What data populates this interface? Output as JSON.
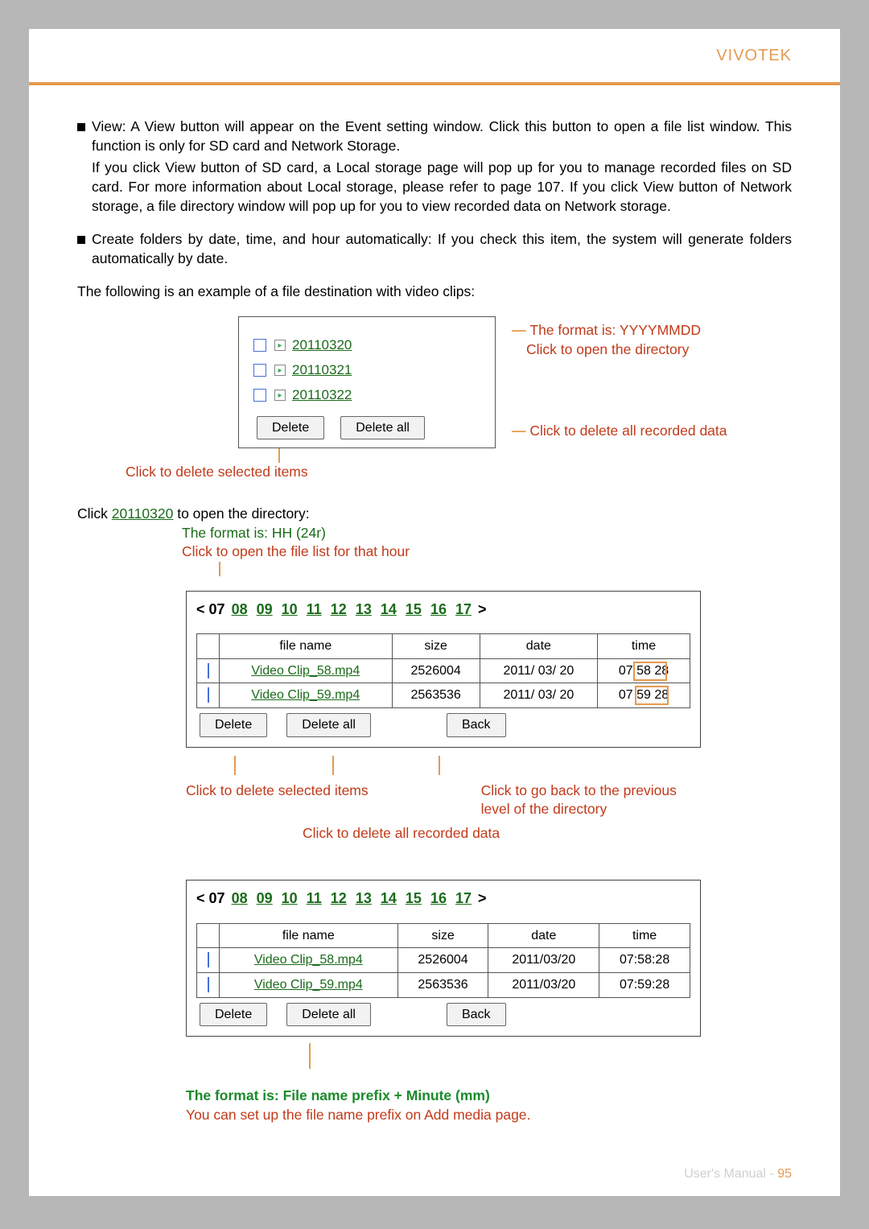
{
  "brand": "VIVOTEK",
  "view_para_1": "View: A View button will appear on the Event setting window. Click this button to open a file list window. This function is only for SD card and Network Storage.",
  "view_para_2": "If you click View button of SD card, a Local storage page will pop up for you to manage recorded files on SD card. For more information about Local storage, please refer to page 107. If you click View button of Network storage, a file directory window will pop up for you to view recorded data on Network storage.",
  "create_para": "Create folders by date, time, and hour automatically: If you check this item, the system will generate folders automatically by date.",
  "example_intro": "The following is an example of a file destination with video clips:",
  "folders": [
    "20110320",
    "20110321",
    "20110322"
  ],
  "delete_label": "Delete",
  "delete_all_label": "Delete all",
  "back_label": "Back",
  "ann_format_date": "The format is: YYYYMMDD",
  "ann_open_dir": "Click to open the directory",
  "ann_del_all": "Click to delete all recorded data",
  "ann_del_sel": "Click to delete selected items",
  "click_folder_pre": "Click ",
  "click_folder_link": "20110320",
  "click_folder_post": " to open the directory:",
  "ann_format_hh": "The format is: HH (24r)",
  "ann_open_hour": "Click to open the file list for that hour",
  "hours_current": "07",
  "hours": [
    "08",
    "09",
    "10",
    "11",
    "12",
    "13",
    "14",
    "15",
    "16",
    "17"
  ],
  "nav_left": "<",
  "nav_right": ">",
  "th_name": "file name",
  "th_size": "size",
  "th_date": "date",
  "th_time": "time",
  "rows1": [
    {
      "name": "Video Clip_58.mp4",
      "size": "2526004",
      "date": "2011/ 03/ 20",
      "time": "07 58 28"
    },
    {
      "name": "Video Clip_59.mp4",
      "size": "2563536",
      "date": "2011/ 03/ 20",
      "time": "07 59 28"
    }
  ],
  "rows2": [
    {
      "name": "Video Clip_58.mp4",
      "size": "2526004",
      "date": "2011/03/20",
      "time": "07:58:28"
    },
    {
      "name": "Video Clip_59.mp4",
      "size": "2563536",
      "date": "2011/03/20",
      "time": "07:59:28"
    }
  ],
  "ann_mid_del": "Click to delete selected items",
  "ann_mid_back": "Click to go back to the previous level of the directory",
  "ann_mid_delall": "Click to delete all recorded data",
  "foot_line1": "The format is: File name prefix + Minute (mm)",
  "foot_line2": "You can set up the file name prefix on Add media page.",
  "footer_text": "User's Manual - ",
  "footer_page": "95"
}
